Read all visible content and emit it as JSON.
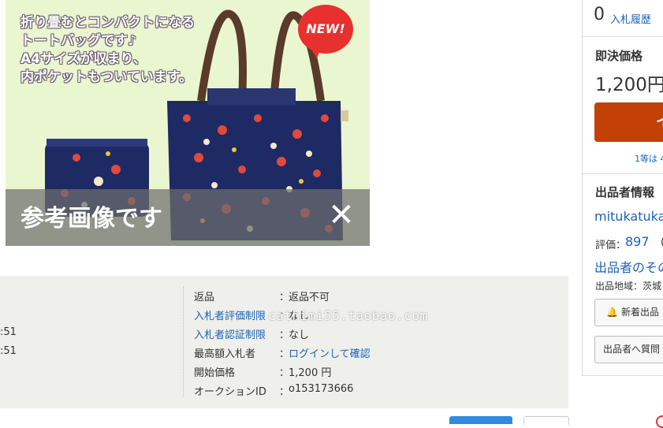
{
  "product": {
    "promo_text": "折り畳むとコンパクトになる\nトートバッグです♪\nA4サイズが収まり、\n内ポケットもついています。",
    "new_badge": "NEW!",
    "reference_label": "参考画像です",
    "close_glyph": "✕",
    "colors": {
      "bag_navy": "#1e2a63",
      "background": "#eaf6cf",
      "badge_red": "#e8302e"
    }
  },
  "info": {
    "left_times": [
      ":51",
      ":51"
    ],
    "rows": [
      {
        "label": "返品",
        "colon": "：",
        "value": "返品不可",
        "label_link": false,
        "value_link": false
      },
      {
        "label": "入札者評価制限",
        "colon": "：",
        "value": "なし",
        "label_link": true,
        "value_link": false
      },
      {
        "label": "入札者認証制限",
        "colon": "：",
        "value": "なし",
        "label_link": true,
        "value_link": false
      },
      {
        "label": "最高額入札者",
        "colon": "：",
        "value": "ログインして確認",
        "label_link": false,
        "value_link": true
      },
      {
        "label": "開始価格",
        "colon": "：",
        "value": "1,200 円",
        "label_link": false,
        "value_link": false
      },
      {
        "label": "オークションID",
        "colon": "：",
        "value": "o153173666",
        "label_link": false,
        "value_link": false
      }
    ],
    "watermark": "cathimi55.taobao.com"
  },
  "sidebar": {
    "bid_count": "0",
    "bid_history": "入札履歴",
    "buynow_label": "即決価格",
    "buynow_price": "1,200円",
    "buy_button_text": "イ",
    "buy_note": "1等は 4",
    "seller_heading": "出品者情報",
    "seller_name": "mitukatuka",
    "rating_label": "評価：",
    "rating_value": "897",
    "rating_paren": "(",
    "seller_other": "出品者のその",
    "seller_region": "出品地域：茨城",
    "new_listing_button": "新着出品",
    "question_button": "出品者へ質問"
  },
  "colors": {
    "link": "#1b63b8",
    "buy_button": "#c34106",
    "panel_bg": "#efefeb"
  }
}
